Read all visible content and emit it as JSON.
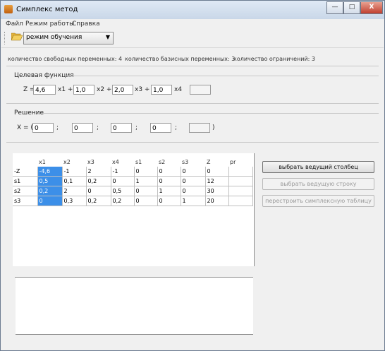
{
  "window": {
    "title": "Симплекс метод",
    "controls": {
      "minimize": "—",
      "maximize": "□",
      "close": "X"
    }
  },
  "menu": {
    "items": [
      "Файл",
      "Режим работы",
      "Справка"
    ]
  },
  "toolbar": {
    "mode_value": "режим обучения",
    "icon": "folder-open-icon"
  },
  "info": {
    "free_vars": "количество свободных переменных: 4",
    "basis_vars": "количество базисных переменных: 3",
    "constraints": "количество ограничений: 3"
  },
  "objective": {
    "label": "Целевая функция",
    "z_label": "Z =",
    "coefs": [
      "4,6",
      "1,0",
      "2,0",
      "1,0"
    ],
    "terms": [
      "x1 +",
      "x2 +",
      "x3 +",
      "x4"
    ],
    "extra": ""
  },
  "solution": {
    "label": "Решение",
    "prefix": "X = (",
    "values": [
      "0",
      "0",
      "0",
      "0",
      ""
    ],
    "seps": [
      ";",
      ";",
      ";",
      ";"
    ],
    "suffix": ")"
  },
  "table": {
    "headers": [
      "",
      "x1",
      "x2",
      "x3",
      "x4",
      "s1",
      "s2",
      "s3",
      "Z",
      "pr"
    ],
    "rows": [
      [
        "-Z",
        "-4,6",
        "-1",
        "2",
        "-1",
        "0",
        "0",
        "0",
        "0",
        ""
      ],
      [
        "s1",
        "0,5",
        "0,1",
        "0,2",
        "0",
        "1",
        "0",
        "0",
        "12",
        ""
      ],
      [
        "s2",
        "0,2",
        "2",
        "0",
        "0,5",
        "0",
        "1",
        "0",
        "30",
        ""
      ],
      [
        "s3",
        "0",
        "0,3",
        "0,2",
        "0,2",
        "0",
        "0",
        "1",
        "20",
        ""
      ]
    ],
    "selected_column": 1,
    "selected_color": "#3c8fe8"
  },
  "buttons": {
    "choose_column": "выбрать ведущий столбец",
    "choose_row": "выбрать ведущую строку",
    "rebuild": "перестроить симплексную таблицу"
  }
}
